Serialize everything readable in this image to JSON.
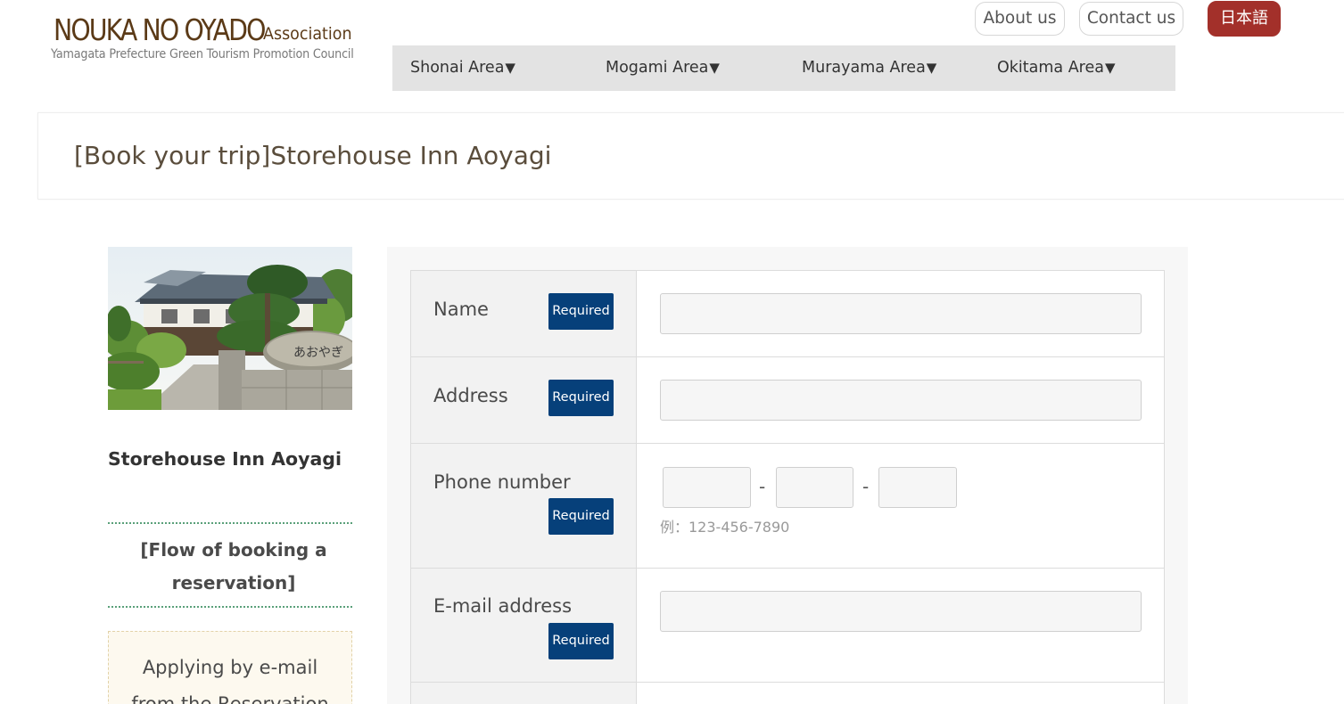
{
  "header": {
    "logo_main": "NOUKA NO OYADO",
    "logo_assoc": "Association",
    "logo_sub": "Yamagata Prefecture Green Tourism Promotion Council",
    "about_label": "About us",
    "contact_label": "Contact us",
    "lang_label": "日本語"
  },
  "nav": {
    "items": [
      {
        "label": "Shonai Area",
        "arrow": "▼"
      },
      {
        "label": "Mogami Area",
        "arrow": "▼"
      },
      {
        "label": "Murayama Area",
        "arrow": "▼"
      },
      {
        "label": "Okitama Area",
        "arrow": "▼"
      }
    ]
  },
  "page": {
    "title": "[Book your trip]Storehouse Inn Aoyagi"
  },
  "sidebar": {
    "inn_name": "Storehouse Inn Aoyagi",
    "photo_sign_text": "あおやぎ",
    "flow_heading": "[Flow of booking a reservation]",
    "apply_text": "Applying by e-mail from the Reservation"
  },
  "form": {
    "required_label": "Required",
    "fields": [
      {
        "label": "Name",
        "value": ""
      },
      {
        "label": "Address",
        "value": ""
      },
      {
        "label": "Phone number",
        "value": ""
      },
      {
        "label": "E-mail address",
        "value": ""
      }
    ],
    "phone": {
      "part1": "",
      "part2": "",
      "part3": "",
      "separator": "-",
      "example": "例：123-456-7890"
    }
  },
  "colors": {
    "brand_brown": "#5b3a17",
    "lang_button": "#a3302a",
    "required_badge": "#06407a",
    "nav_bg": "#e3e3e3",
    "flow_border": "#5aa07a"
  }
}
